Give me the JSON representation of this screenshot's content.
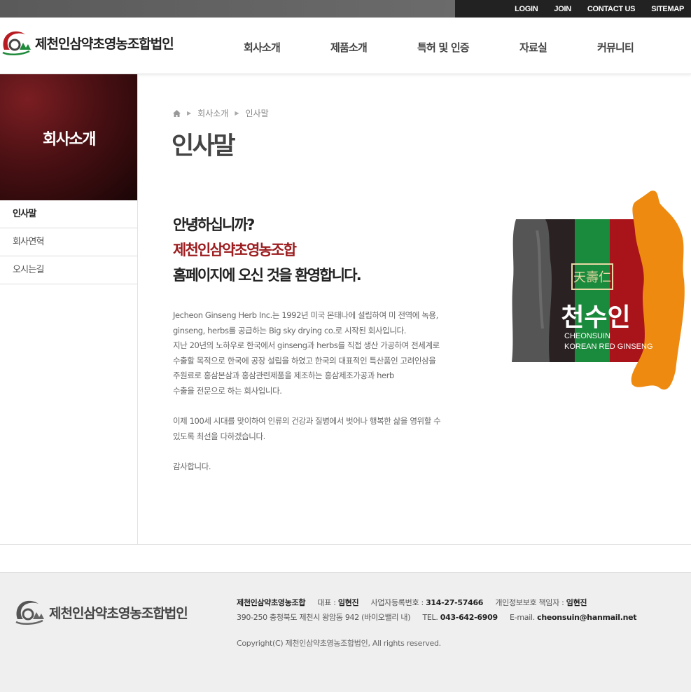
{
  "topbar": {
    "links": [
      "LOGIN",
      "JOIN",
      "CONTACT US",
      "SITEMAP"
    ]
  },
  "header": {
    "logo_text": "제천인삼약초영농조합법인",
    "nav": [
      "회사소개",
      "제품소개",
      "특허 및 인증",
      "자료실",
      "커뮤니티"
    ]
  },
  "sidebar": {
    "title": "회사소개",
    "items": [
      {
        "label": "인사말",
        "active": true
      },
      {
        "label": "회사연혁",
        "active": false
      },
      {
        "label": "오시는길",
        "active": false
      }
    ]
  },
  "content": {
    "breadcrumb": [
      "회사소개",
      "인사말"
    ],
    "title": "인사말",
    "greeting_line1": "안녕하십니까?",
    "greeting_line2": "제천인삼약초영농조합",
    "greeting_line3": "홈페이지에 오신 것을 환영합니다.",
    "paragraph1": [
      "Jecheon Ginseng Herb Inc.는 1992년 미국 몬태나에 설립하여 미 전역에 녹용,",
      "ginseng, herbs를 공급하는 Big sky drying co.로 시작된 회사입니다.",
      "지난 20년의 노하우로 한국에서 ginseng과 herbs를 직접 생산 가공하여 전세계로",
      "수출할 목적으로 한국에 공장 설립을 하였고 한국의 대표적인 특산품인 고려인삼을",
      "주원료로 홍삼본삼과 홍삼관련제품을 제조하는 홍삼제조가공과 herb",
      "수출을 전문으로 하는 회사입니다."
    ],
    "paragraph2": [
      "이제 100세 시대를 맞이하여 인류의 건강과 질병에서 벗어나 행복한 삶을 영위할 수",
      "있도록 최선을 다하겠습니다."
    ],
    "closing": "감사합니다."
  },
  "product_image": {
    "stamp_text": "천수인",
    "brand_line1": "CHEONSUIN",
    "brand_line2": "KOREAN RED GINSENG",
    "colors": {
      "orange": "#ee8a10",
      "red": "#a8141a",
      "green": "#1a8a3c",
      "dark": "#2a2222",
      "gray": "#555555"
    }
  },
  "footer": {
    "logo_text": "제천인삼약초영농조합법인",
    "company": "제천인삼약초영농조합",
    "ceo_label": "대표 : ",
    "ceo": "임현진",
    "biz_label": "사업자등록번호 : ",
    "biz_no": "314-27-57466",
    "privacy_label": "개인정보보호 책임자 : ",
    "privacy_officer": "임현진",
    "address": "390-250 충청북도 제천시 왕암동 942 (바이오밸리 내)",
    "tel_label": "TEL. ",
    "tel": "043-642-6909",
    "email_label": "E-mail. ",
    "email": "cheonsuin@hanmail.net",
    "copyright": "Copyright(C) 제천인삼약초영농조합법인, All rights reserved."
  }
}
